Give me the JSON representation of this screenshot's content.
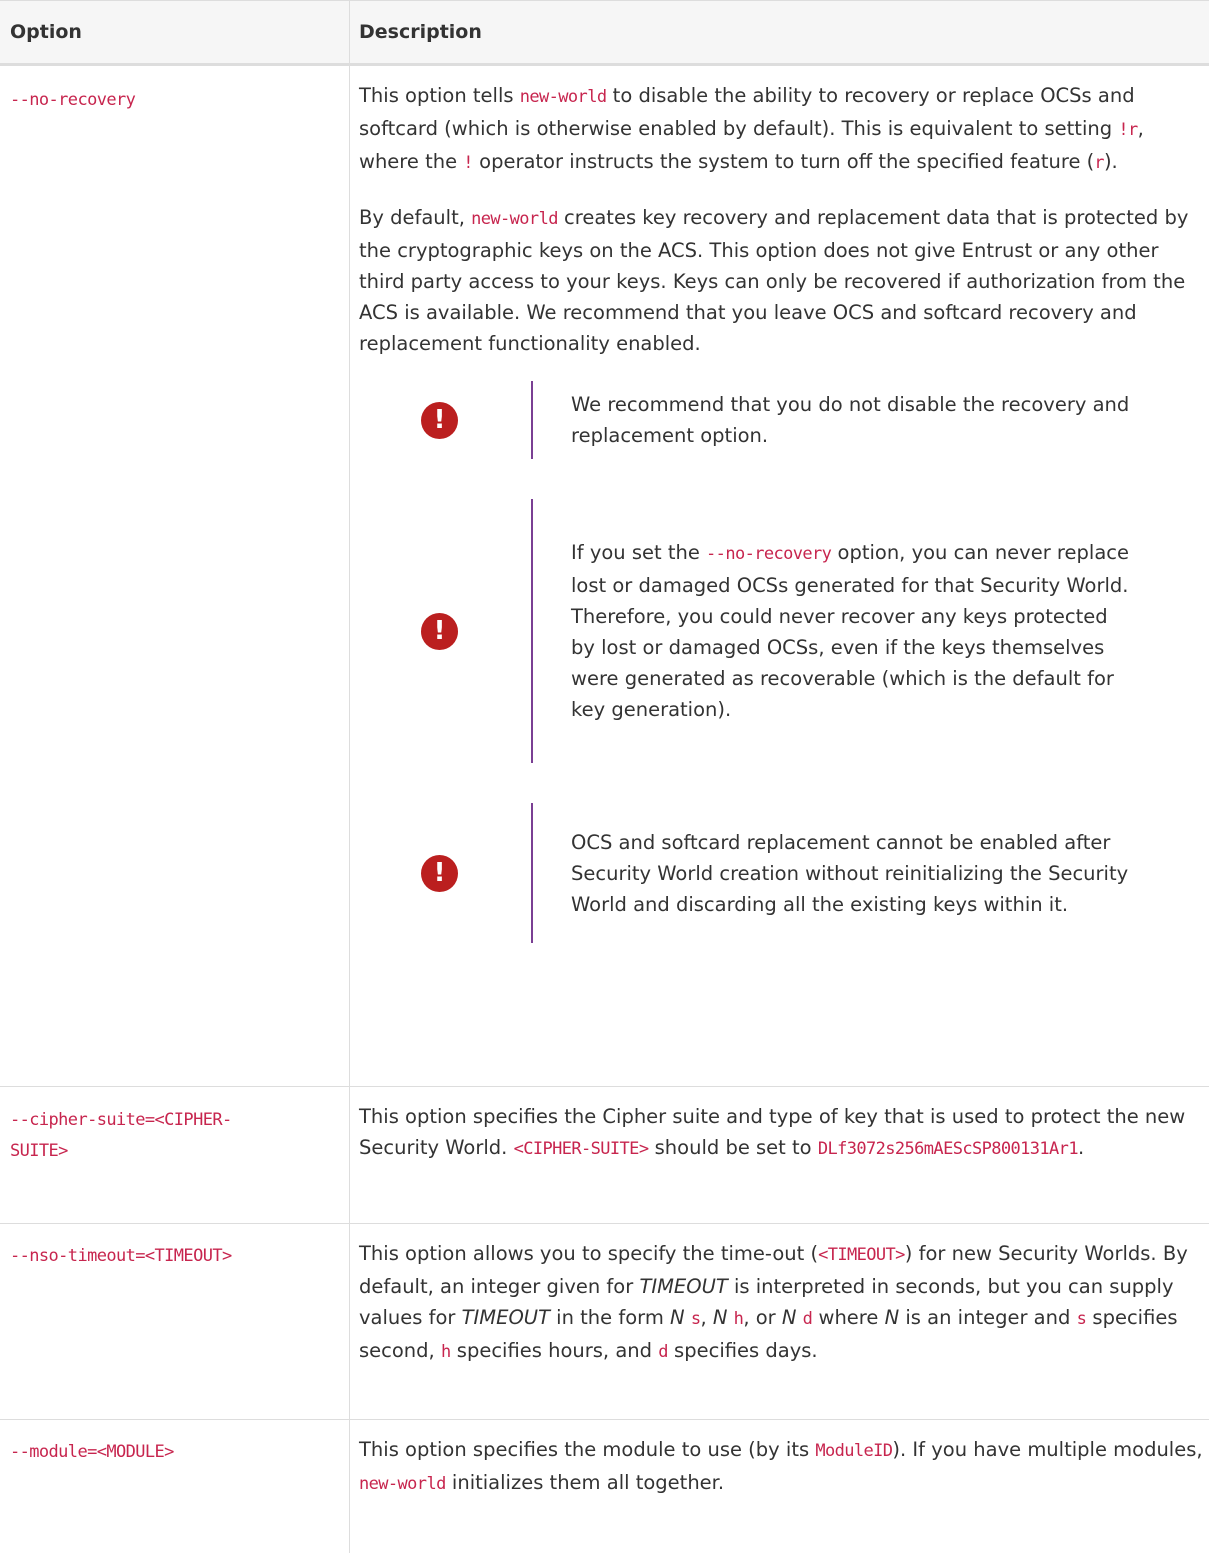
{
  "header": {
    "option": "Option",
    "description": "Description"
  },
  "rows": [
    {
      "option": "--no-recovery",
      "p1": {
        "t1": "This option tells ",
        "c1": "new-world",
        "t2": " to disable the ability to recovery or replace OCSs and softcard (which is otherwise enabled by default). This is equivalent to setting ",
        "c2": "!r",
        "t3": ", where the ",
        "c3": "!",
        "t4": " operator instructs the system to turn off the specified feature (",
        "c4": "r",
        "t5": ")."
      },
      "p2": {
        "t1": "By default, ",
        "c1": "new-world",
        "t2": " creates key recovery and replacement data that is protected by the cryptographic keys on the ACS. This option does not give Entrust or any other third party access to your keys. Keys can only be recovered if authorization from the ACS is available. We recommend that you leave OCS and softcard recovery and replacement functionality enabled."
      },
      "notes": [
        {
          "icon": "exclamation-icon",
          "text": "We recommend that you do not disable the recovery and replacement option."
        },
        {
          "icon": "exclamation-icon",
          "t1": "If you set the ",
          "c1": "--no-recovery",
          "t2": " option, you can never replace lost or damaged OCSs generated for that Security World. Therefore, you could never recover any keys protected by lost or damaged OCSs, even if the keys themselves were generated as recoverable (which is the default for key generation)."
        },
        {
          "icon": "exclamation-icon",
          "text": "OCS and softcard replacement cannot be enabled after Security World creation without reinitializing the Security World and discarding all the existing keys within it."
        }
      ]
    },
    {
      "option_a": "--cipher-suite=<CIPHER-",
      "option_b": "SUITE>",
      "t1": "This option specifies the Cipher suite and type of key that is used to protect the new Security World. ",
      "c1": "<CIPHER-SUITE>",
      "t2": " should be set to ",
      "c2": "DLf3072s256mAEScSP800131Ar1",
      "t3": "."
    },
    {
      "option": "--nso-timeout=<TIMEOUT>",
      "t1": "This option allows you to specify the time-out (",
      "c1": "<TIMEOUT>",
      "t2": ") for new Security Worlds. By default, an integer given for ",
      "e1": "TIMEOUT",
      "t3": " is interpreted in seconds, but you can supply values for ",
      "e2": "TIMEOUT",
      "t4": " in the form ",
      "e3": "N",
      "c2": "s",
      "t5": ", ",
      "e4": "N",
      "c3": "h",
      "t6": ", or ",
      "e5": "N",
      "c4": "d",
      "t7": " where ",
      "e6": "N",
      "t8": " is an integer and ",
      "c5": "s",
      "t9": " specifies second, ",
      "c6": "h",
      "t10": " specifies hours, and ",
      "c7": "d",
      "t11": " specifies days."
    },
    {
      "option": "--module=<MODULE>",
      "t1": "This option specifies the module to use (by its ",
      "c1": "ModuleID",
      "t2": "). If you have multiple modules, ",
      "c2": "new-world",
      "t3": " initializes them all together."
    }
  ],
  "colors": {
    "code": "#c7254e",
    "warning": "#bb1f1f",
    "note_bar": "#7a3f93"
  }
}
